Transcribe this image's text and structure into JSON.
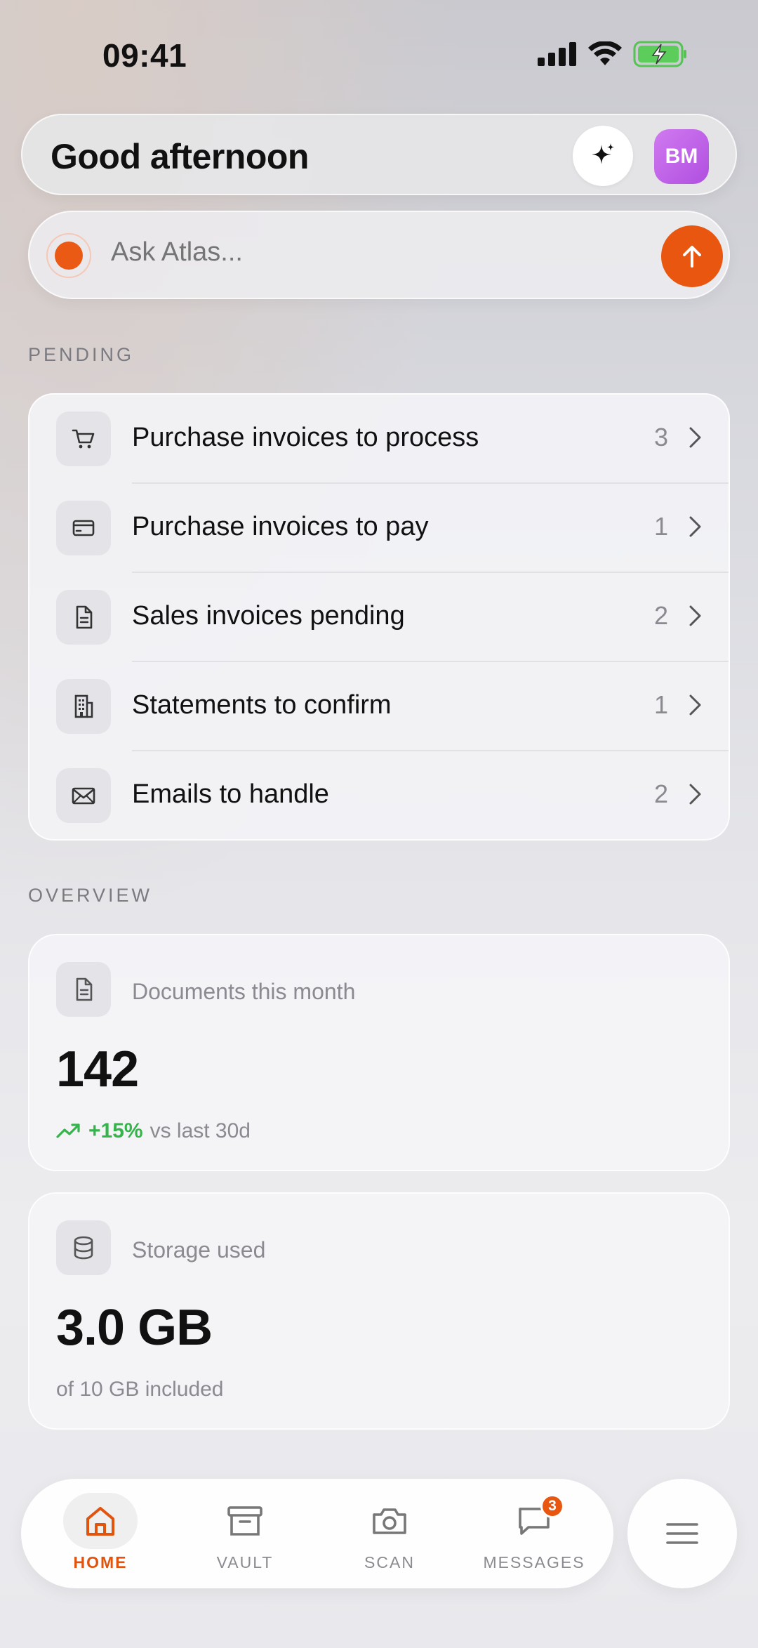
{
  "status_bar": {
    "time": "09:41"
  },
  "header": {
    "greeting": "Good afternoon",
    "avatar_initials": "BM"
  },
  "ask": {
    "placeholder": "Ask Atlas..."
  },
  "pending": {
    "section_label": "PENDING",
    "items": [
      {
        "icon": "cart-icon",
        "label": "Purchase invoices to process",
        "count": "3"
      },
      {
        "icon": "credit-card-icon",
        "label": "Purchase invoices to pay",
        "count": "1"
      },
      {
        "icon": "document-icon",
        "label": "Sales invoices pending",
        "count": "2"
      },
      {
        "icon": "building-icon",
        "label": "Statements to confirm",
        "count": "1"
      },
      {
        "icon": "envelope-icon",
        "label": "Emails to handle",
        "count": "2"
      }
    ]
  },
  "overview": {
    "section_label": "OVERVIEW",
    "documents": {
      "title": "Documents this month",
      "value": "142",
      "trend": "+15%",
      "trend_suffix": "vs last 30d"
    },
    "storage": {
      "title": "Storage used",
      "value": "3.0 GB",
      "subtitle": "of 10 GB included"
    }
  },
  "tabbar": {
    "tabs": [
      {
        "label": "HOME",
        "icon": "home-icon",
        "active": true
      },
      {
        "label": "VAULT",
        "icon": "archive-icon",
        "active": false
      },
      {
        "label": "SCAN",
        "icon": "camera-icon",
        "active": false
      },
      {
        "label": "MESSAGES",
        "icon": "chat-icon",
        "active": false,
        "badge": "3"
      }
    ]
  },
  "colors": {
    "accent": "#e8560f",
    "trend": "#34b44a",
    "avatar": "#c064e8"
  }
}
